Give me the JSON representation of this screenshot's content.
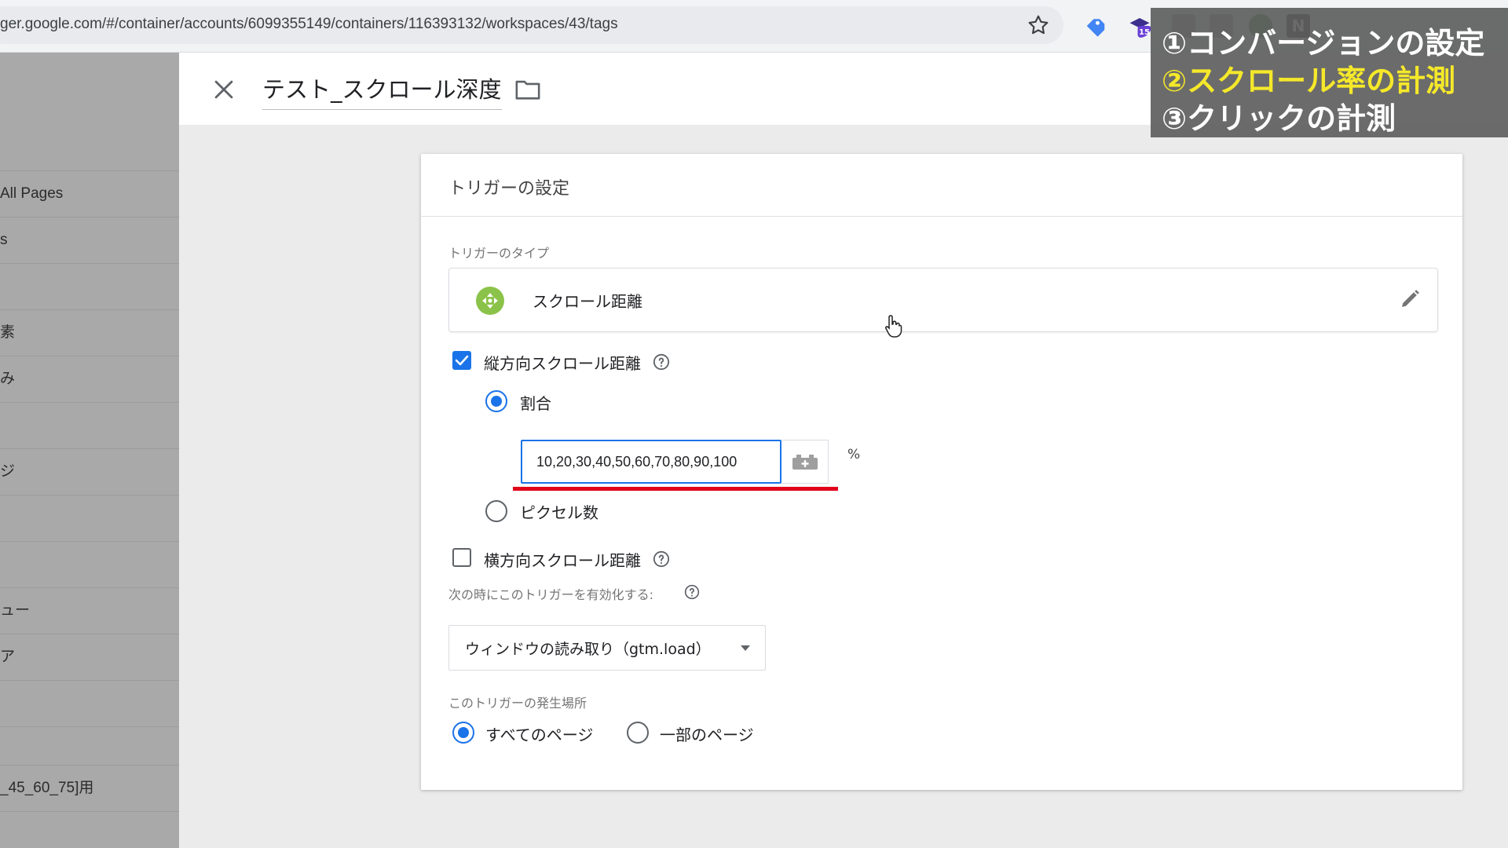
{
  "browser": {
    "url": "ger.google.com/#/container/accounts/6099355149/containers/116393132/workspaces/43/tags",
    "extension_badge": "15",
    "notion_label": "N"
  },
  "sidebar": {
    "items": [
      "All Pages",
      "s",
      "",
      "素",
      "み",
      "",
      "ジ",
      "",
      "",
      "ュー",
      "ア",
      "",
      "_45_60_75]用"
    ]
  },
  "tag": {
    "title": "テスト_スクロール深度"
  },
  "trigger_settings": {
    "header": "トリガーの設定",
    "type_label": "トリガーのタイプ",
    "type_name": "スクロール距離",
    "vertical": {
      "label": "縦方向スクロール距離",
      "checked": true,
      "percentage_label": "割合",
      "percentage_value": "10,20,30,40,50,60,70,80,90,100",
      "percent_unit": "%",
      "pixels_label": "ピクセル数"
    },
    "horizontal": {
      "label": "横方向スクロール距離",
      "checked": false
    },
    "enable_when_label": "次の時にこのトリガーを有効化する:",
    "enable_when_value": "ウィンドウの読み取り（gtm.load）",
    "fires_on_label": "このトリガーの発生場所",
    "fires_on_options": [
      "すべてのページ",
      "一部のページ"
    ]
  },
  "overlay": {
    "lines": [
      "①コンバージョンの設定",
      "②スクロール率の計測",
      "③クリックの計測"
    ],
    "highlight_color": "#f5e82a",
    "text_color": "#ffffff"
  },
  "colors": {
    "accent": "#1a73e8",
    "underline": "#e0001b",
    "scroll_icon": "#8bc34a"
  }
}
